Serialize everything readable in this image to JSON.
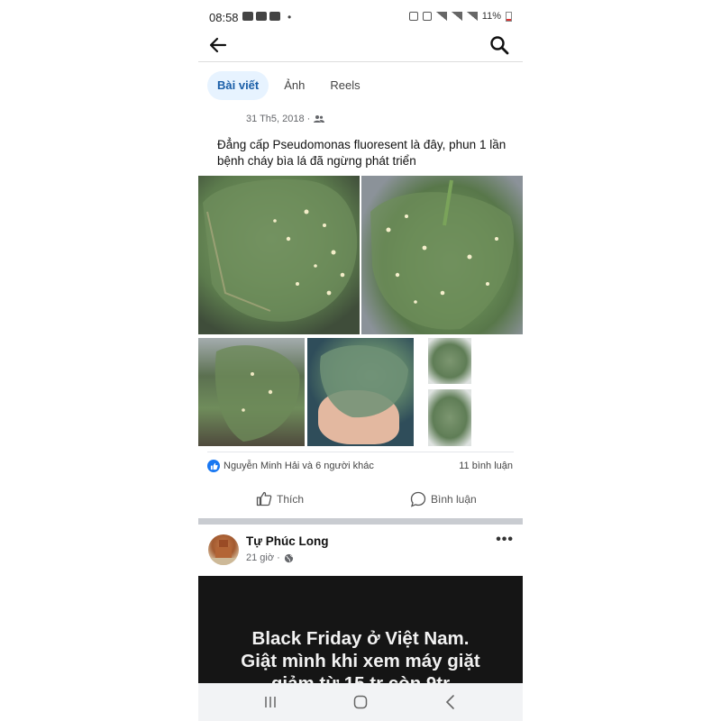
{
  "status_bar": {
    "time": "08:58",
    "dot": "•",
    "battery": "11%"
  },
  "tabs": [
    {
      "label": "Bài viết",
      "active": true
    },
    {
      "label": "Ảnh",
      "active": false
    },
    {
      "label": "Reels",
      "active": false
    }
  ],
  "post1": {
    "date": "31 Th5, 2018 ·",
    "text": "Đẳng cấp Pseudomonas fluoresent là đây, phun 1 lần bệnh cháy bìa lá đã ngừng phát triển",
    "reactions": "Nguyễn Minh Hải và 6 người khác",
    "comments": "11 bình luận",
    "like_label": "Thích",
    "comment_label": "Bình luận"
  },
  "post2": {
    "author": "Tự Phúc Long",
    "time": "21 giờ ·",
    "more": "•••",
    "image_text": [
      "Black Friday ở Việt Nam.",
      "Giật mình khi xem máy giặt",
      "giảm từ 15 tr còn 9tr"
    ]
  },
  "icons": {
    "back": "arrow-left-icon",
    "search": "search-icon",
    "friends": "friends-icon",
    "globe": "globe-icon",
    "like": "thumbs-up-icon",
    "comment": "comment-icon"
  },
  "colors": {
    "accent": "#1877f2",
    "tab_active_bg": "#e7f3ff",
    "tab_active_text": "#1b5fa8"
  }
}
